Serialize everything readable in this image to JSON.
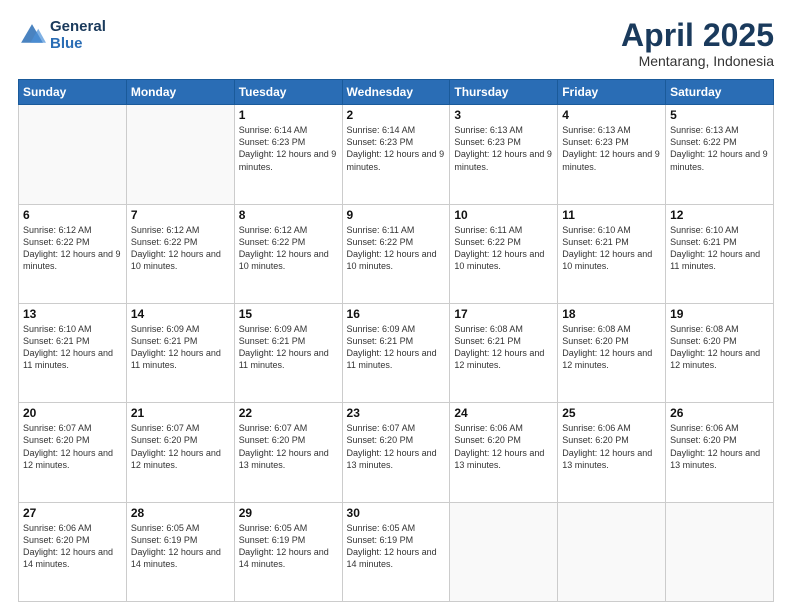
{
  "logo": {
    "line1": "General",
    "line2": "Blue"
  },
  "title": "April 2025",
  "subtitle": "Mentarang, Indonesia",
  "days_header": [
    "Sunday",
    "Monday",
    "Tuesday",
    "Wednesday",
    "Thursday",
    "Friday",
    "Saturday"
  ],
  "weeks": [
    [
      {
        "num": "",
        "info": ""
      },
      {
        "num": "",
        "info": ""
      },
      {
        "num": "1",
        "info": "Sunrise: 6:14 AM\nSunset: 6:23 PM\nDaylight: 12 hours and 9 minutes."
      },
      {
        "num": "2",
        "info": "Sunrise: 6:14 AM\nSunset: 6:23 PM\nDaylight: 12 hours and 9 minutes."
      },
      {
        "num": "3",
        "info": "Sunrise: 6:13 AM\nSunset: 6:23 PM\nDaylight: 12 hours and 9 minutes."
      },
      {
        "num": "4",
        "info": "Sunrise: 6:13 AM\nSunset: 6:23 PM\nDaylight: 12 hours and 9 minutes."
      },
      {
        "num": "5",
        "info": "Sunrise: 6:13 AM\nSunset: 6:22 PM\nDaylight: 12 hours and 9 minutes."
      }
    ],
    [
      {
        "num": "6",
        "info": "Sunrise: 6:12 AM\nSunset: 6:22 PM\nDaylight: 12 hours and 9 minutes."
      },
      {
        "num": "7",
        "info": "Sunrise: 6:12 AM\nSunset: 6:22 PM\nDaylight: 12 hours and 10 minutes."
      },
      {
        "num": "8",
        "info": "Sunrise: 6:12 AM\nSunset: 6:22 PM\nDaylight: 12 hours and 10 minutes."
      },
      {
        "num": "9",
        "info": "Sunrise: 6:11 AM\nSunset: 6:22 PM\nDaylight: 12 hours and 10 minutes."
      },
      {
        "num": "10",
        "info": "Sunrise: 6:11 AM\nSunset: 6:22 PM\nDaylight: 12 hours and 10 minutes."
      },
      {
        "num": "11",
        "info": "Sunrise: 6:10 AM\nSunset: 6:21 PM\nDaylight: 12 hours and 10 minutes."
      },
      {
        "num": "12",
        "info": "Sunrise: 6:10 AM\nSunset: 6:21 PM\nDaylight: 12 hours and 11 minutes."
      }
    ],
    [
      {
        "num": "13",
        "info": "Sunrise: 6:10 AM\nSunset: 6:21 PM\nDaylight: 12 hours and 11 minutes."
      },
      {
        "num": "14",
        "info": "Sunrise: 6:09 AM\nSunset: 6:21 PM\nDaylight: 12 hours and 11 minutes."
      },
      {
        "num": "15",
        "info": "Sunrise: 6:09 AM\nSunset: 6:21 PM\nDaylight: 12 hours and 11 minutes."
      },
      {
        "num": "16",
        "info": "Sunrise: 6:09 AM\nSunset: 6:21 PM\nDaylight: 12 hours and 11 minutes."
      },
      {
        "num": "17",
        "info": "Sunrise: 6:08 AM\nSunset: 6:21 PM\nDaylight: 12 hours and 12 minutes."
      },
      {
        "num": "18",
        "info": "Sunrise: 6:08 AM\nSunset: 6:20 PM\nDaylight: 12 hours and 12 minutes."
      },
      {
        "num": "19",
        "info": "Sunrise: 6:08 AM\nSunset: 6:20 PM\nDaylight: 12 hours and 12 minutes."
      }
    ],
    [
      {
        "num": "20",
        "info": "Sunrise: 6:07 AM\nSunset: 6:20 PM\nDaylight: 12 hours and 12 minutes."
      },
      {
        "num": "21",
        "info": "Sunrise: 6:07 AM\nSunset: 6:20 PM\nDaylight: 12 hours and 12 minutes."
      },
      {
        "num": "22",
        "info": "Sunrise: 6:07 AM\nSunset: 6:20 PM\nDaylight: 12 hours and 13 minutes."
      },
      {
        "num": "23",
        "info": "Sunrise: 6:07 AM\nSunset: 6:20 PM\nDaylight: 12 hours and 13 minutes."
      },
      {
        "num": "24",
        "info": "Sunrise: 6:06 AM\nSunset: 6:20 PM\nDaylight: 12 hours and 13 minutes."
      },
      {
        "num": "25",
        "info": "Sunrise: 6:06 AM\nSunset: 6:20 PM\nDaylight: 12 hours and 13 minutes."
      },
      {
        "num": "26",
        "info": "Sunrise: 6:06 AM\nSunset: 6:20 PM\nDaylight: 12 hours and 13 minutes."
      }
    ],
    [
      {
        "num": "27",
        "info": "Sunrise: 6:06 AM\nSunset: 6:20 PM\nDaylight: 12 hours and 14 minutes."
      },
      {
        "num": "28",
        "info": "Sunrise: 6:05 AM\nSunset: 6:19 PM\nDaylight: 12 hours and 14 minutes."
      },
      {
        "num": "29",
        "info": "Sunrise: 6:05 AM\nSunset: 6:19 PM\nDaylight: 12 hours and 14 minutes."
      },
      {
        "num": "30",
        "info": "Sunrise: 6:05 AM\nSunset: 6:19 PM\nDaylight: 12 hours and 14 minutes."
      },
      {
        "num": "",
        "info": ""
      },
      {
        "num": "",
        "info": ""
      },
      {
        "num": "",
        "info": ""
      }
    ]
  ]
}
